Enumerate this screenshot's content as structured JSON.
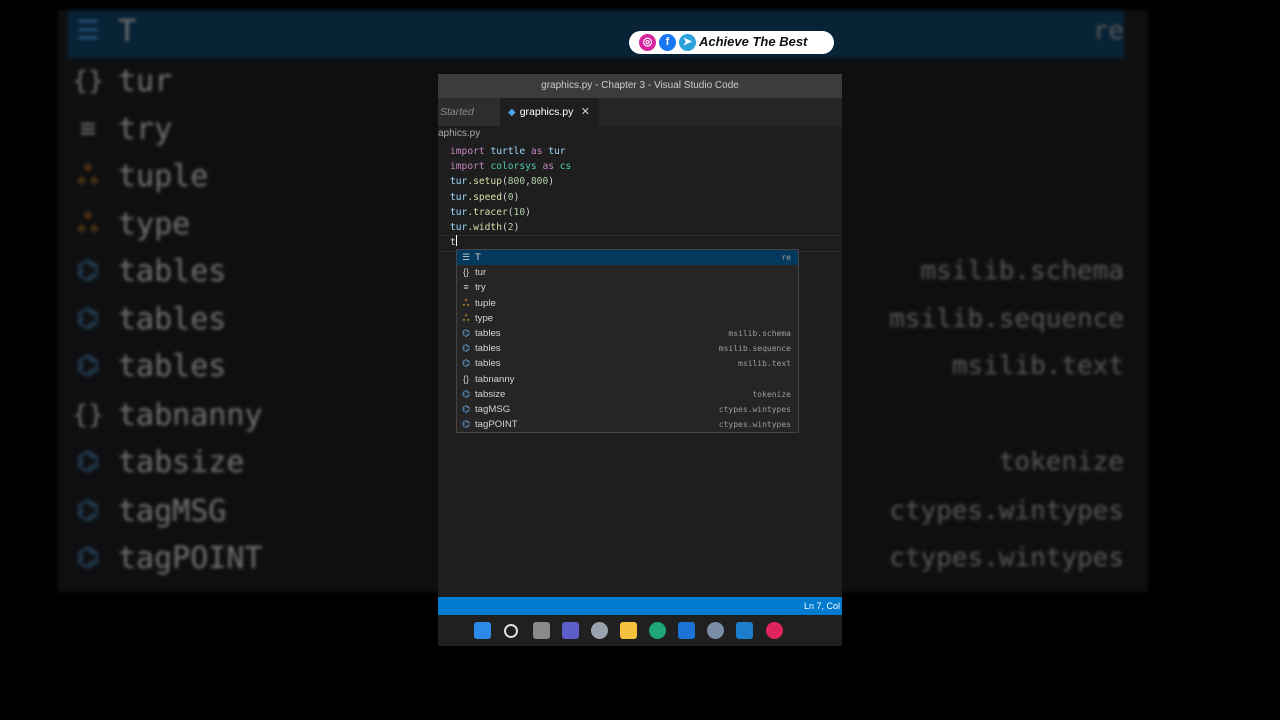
{
  "badge": {
    "text": "Achieve The Best",
    "icons": [
      "instagram-icon",
      "facebook-icon",
      "telegram-icon"
    ]
  },
  "window": {
    "title": "graphics.py - Chapter 3 - Visual Studio Code"
  },
  "tabs": [
    {
      "label": "Started",
      "active": false
    },
    {
      "label": "graphics.py",
      "active": true,
      "close": "✕"
    }
  ],
  "breadcrumb": "aphics.py",
  "code_lines": [
    "import turtle as tur",
    "import colorsys as cs",
    "tur.setup(800,800)",
    "tur.speed(0)",
    "tur.tracer(10)",
    "tur.width(2)",
    "t"
  ],
  "suggestions": [
    {
      "icon": "text-icon",
      "label": "T",
      "detail": "re",
      "selected": true
    },
    {
      "icon": "module-icon",
      "label": "tur",
      "detail": ""
    },
    {
      "icon": "snippet-icon",
      "label": "try",
      "detail": ""
    },
    {
      "icon": "class-icon",
      "label": "tuple",
      "detail": ""
    },
    {
      "icon": "class-icon",
      "label": "type",
      "detail": ""
    },
    {
      "icon": "variable-icon",
      "label": "tables",
      "detail": "msilib.schema"
    },
    {
      "icon": "variable-icon",
      "label": "tables",
      "detail": "msilib.sequence"
    },
    {
      "icon": "variable-icon",
      "label": "tables",
      "detail": "msilib.text"
    },
    {
      "icon": "module-icon",
      "label": "tabnanny",
      "detail": ""
    },
    {
      "icon": "variable-icon",
      "label": "tabsize",
      "detail": "tokenize"
    },
    {
      "icon": "variable-icon",
      "label": "tagMSG",
      "detail": "ctypes.wintypes"
    },
    {
      "icon": "variable-icon",
      "label": "tagPOINT",
      "detail": "ctypes.wintypes"
    }
  ],
  "status": {
    "position": "Ln 7, Col"
  },
  "taskbar": [
    "windows-start-icon",
    "search-icon",
    "task-view-icon",
    "meet-icon",
    "settings-icon",
    "file-explorer-icon",
    "edge-icon",
    "mail-icon",
    "r-icon",
    "vscode-icon",
    "app-icon"
  ],
  "colors": {
    "statusbar": "#007acc",
    "selection": "#04395e",
    "match_highlight": "#2aaaff"
  }
}
